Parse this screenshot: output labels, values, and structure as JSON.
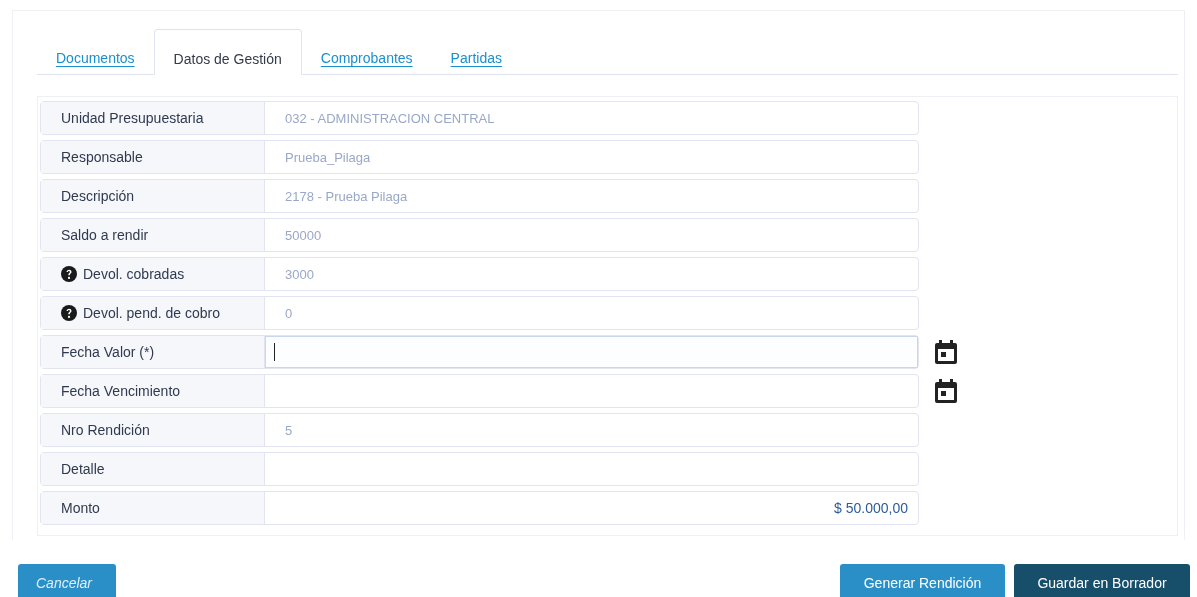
{
  "tabs": [
    {
      "label": "Documentos",
      "selected": false
    },
    {
      "label": "Datos de Gestión",
      "selected": true
    },
    {
      "label": "Comprobantes",
      "selected": false
    },
    {
      "label": "Partidas",
      "selected": false
    }
  ],
  "fields": [
    {
      "label": "Unidad Presupuestaria",
      "value": "032 - ADMINISTRACION CENTRAL",
      "kind": "readonly",
      "help": false,
      "calendar": false
    },
    {
      "label": "Responsable",
      "value": "Prueba_Pilaga",
      "kind": "readonly",
      "help": false,
      "calendar": false
    },
    {
      "label": "Descripción",
      "value": "2178 - Prueba Pilaga",
      "kind": "readonly",
      "help": false,
      "calendar": false
    },
    {
      "label": "Saldo a rendir",
      "value": "50000",
      "kind": "readonly",
      "help": false,
      "calendar": false
    },
    {
      "label": "Devol. cobradas",
      "value": "3000",
      "kind": "readonly",
      "help": true,
      "calendar": false
    },
    {
      "label": "Devol. pend. de cobro",
      "value": "0",
      "kind": "readonly",
      "help": true,
      "calendar": false
    },
    {
      "label": "Fecha Valor (*)",
      "kind": "input",
      "focused": true,
      "help": false,
      "calendar": true
    },
    {
      "label": "Fecha Vencimiento",
      "kind": "input",
      "focused": false,
      "help": false,
      "calendar": true
    },
    {
      "label": "Nro Rendición",
      "value": "5",
      "kind": "readonly",
      "help": false,
      "calendar": false
    },
    {
      "label": "Detalle",
      "kind": "input",
      "focused": false,
      "help": false,
      "calendar": false
    },
    {
      "label": "Monto",
      "value": "$ 50.000,00",
      "kind": "amount",
      "help": false,
      "calendar": false
    }
  ],
  "buttons": [
    {
      "label": "Cancelar",
      "kind": "cancel"
    },
    {
      "label": "Generar Rendición",
      "kind": "secondary"
    },
    {
      "label": "Guardar en Borrador",
      "kind": "primary"
    }
  ]
}
